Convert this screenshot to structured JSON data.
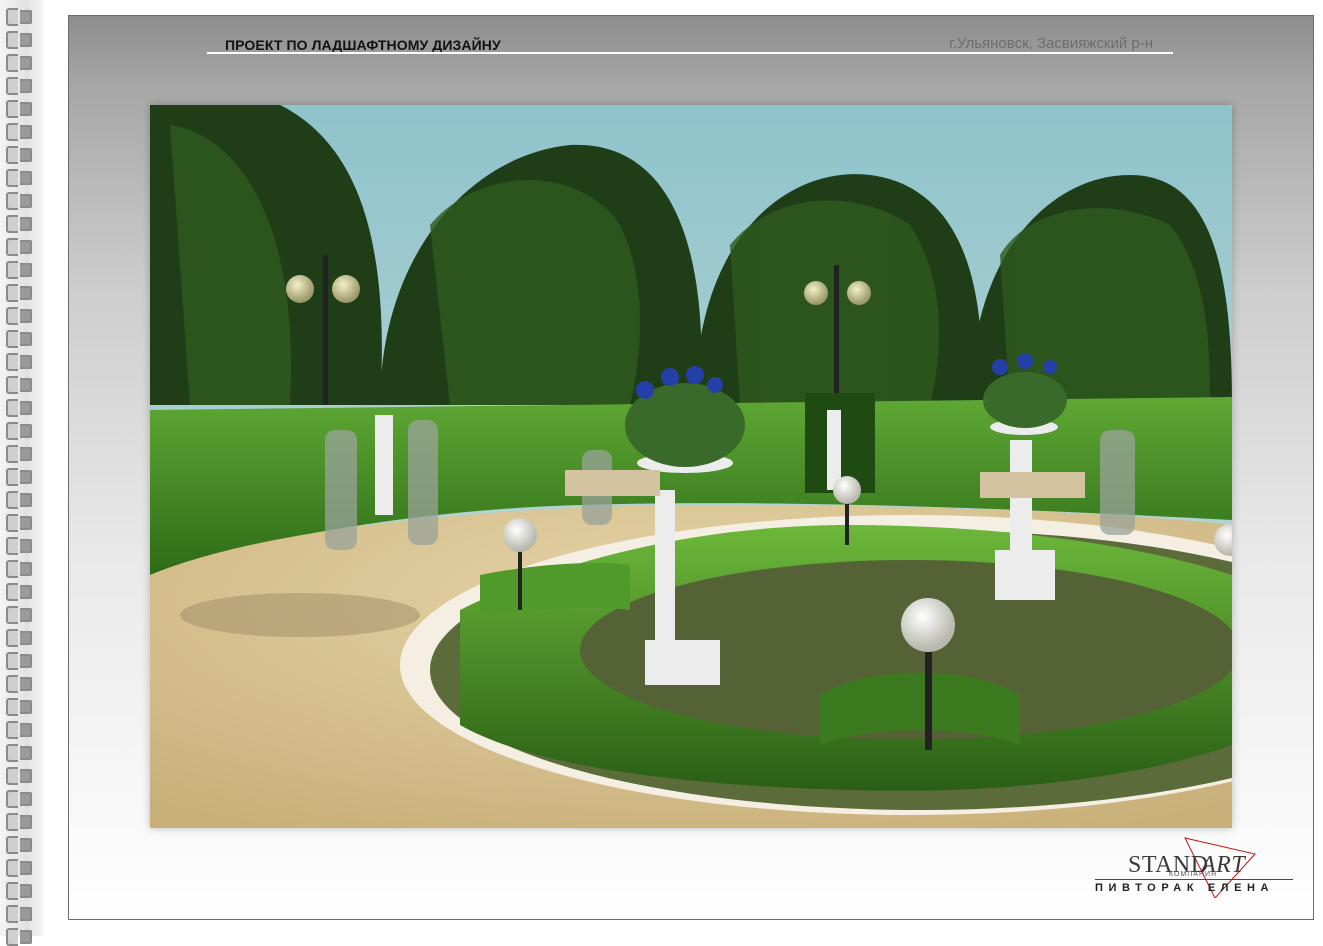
{
  "header": {
    "title": "ПРОЕКТ ПО ЛАДШАФТНОМУ ДИЗАЙНУ",
    "location": "г.Ульяновск, Засвияжский р-н"
  },
  "logo": {
    "brand_part1": "STAND",
    "brand_part2": "ART",
    "company": "КОМПАНИЯ",
    "designer": "ПИВТОРАК ЕЛЕНА",
    "accent_color": "#c21414"
  },
  "render": {
    "subject": "garden-visualization",
    "colors": {
      "sky": "#a9cdd6",
      "hedge": "#3f8a22",
      "path": "#d9c597",
      "tree": "#1f3d16"
    }
  }
}
